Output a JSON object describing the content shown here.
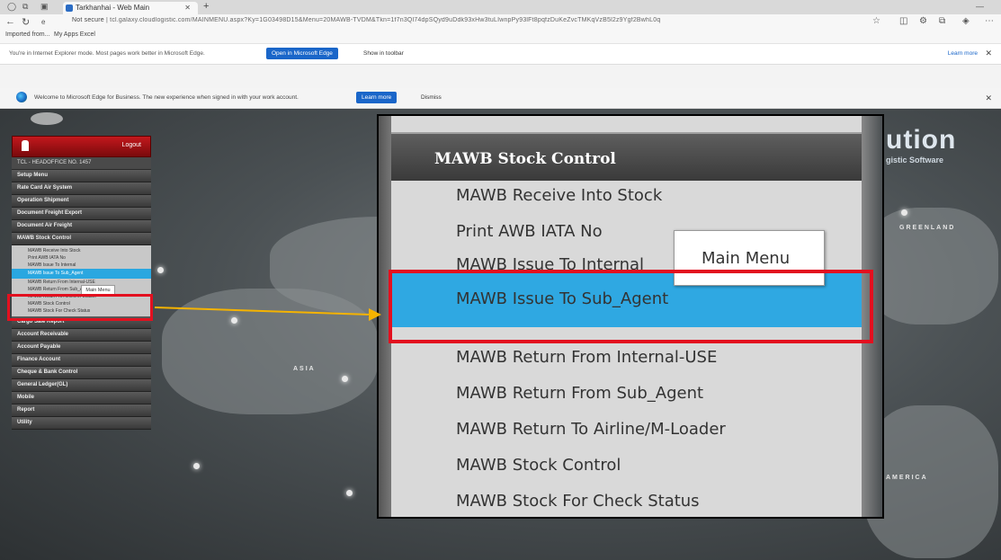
{
  "browser": {
    "tab_title": "Tarkhanhai - Web Main",
    "new_tab": "+",
    "url_prefix": "Not secure",
    "url": "tcl.galaxy.cloudlogistic.com/MAINMENU.aspx?Ky=1G03498D15&Menu=20MAWB-TVDM&Tkn=1f7n3Ql74dpSQyd9uDdk93xHw3tuLIwnpPy93lFt8pqfzDuKeZvcTMKqVzB5l2z9Ygf2BwhL0q",
    "favorites": [
      "Imported from...",
      "My Apps Excel"
    ]
  },
  "ie_bar": {
    "text": "You're in Internet Explorer mode. Most pages work better in Microsoft Edge.",
    "open_button": "Open in Microsoft Edge",
    "show_toolbar": "Show in toolbar",
    "learn_more": "Learn more"
  },
  "edge_bar": {
    "text": "Welcome to Microsoft Edge for Business. The new experience when signed in with your work account.",
    "learn_button": "Learn more",
    "dismiss": "Dismiss"
  },
  "page": {
    "brand": "ution",
    "brand_sub": "gistic Software",
    "labels": [
      "GREENLAND",
      "ASIA",
      "AMERICA"
    ]
  },
  "left_menu": {
    "logout": "Logout",
    "company": "TCL - HEADOFFICE NO. 1457",
    "items_top": [
      "Setup Menu",
      "Rate Card Air System",
      "Operation Shipment",
      "Document Freight Export",
      "Document Air Freight",
      "MAWB Stock Control"
    ],
    "sub_items": [
      "MAWB Receive Into Stock",
      "Print AWB IATA No",
      "MAWB Issue To Internal",
      "MAWB Issue To Sub_Agent",
      "MAWB Return From Internal-USE",
      "MAWB Return From Sub_Agent",
      "MAWB Return To Airline/M-Loader",
      "MAWB Stock Control",
      "MAWB Stock For Check Status"
    ],
    "items_bottom": [
      "Cargo Sale Report",
      "Account Receivable",
      "Account Payable",
      "Finance Account",
      "Cheque & Bank Control",
      "General Ledger(GL)",
      "Mobile",
      "Report",
      "Utility"
    ],
    "mini_popup": "Main Menu"
  },
  "zoom": {
    "title": "MAWB Stock Control",
    "items": [
      "MAWB Receive Into Stock",
      "Print AWB IATA No",
      "MAWB Issue To Internal",
      "MAWB Issue To Sub_Agent",
      "MAWB Return From Internal-USE",
      "MAWB Return From Sub_Agent",
      "MAWB Return To Airline/M-Loader",
      "MAWB Stock Control",
      "MAWB Stock For Check Status"
    ],
    "popup": "Main Menu"
  },
  "colors": {
    "highlight": "#2fa8e2",
    "annotation": "#e3101f",
    "arrow": "#f5b300",
    "menu_head": "#c3181d"
  }
}
